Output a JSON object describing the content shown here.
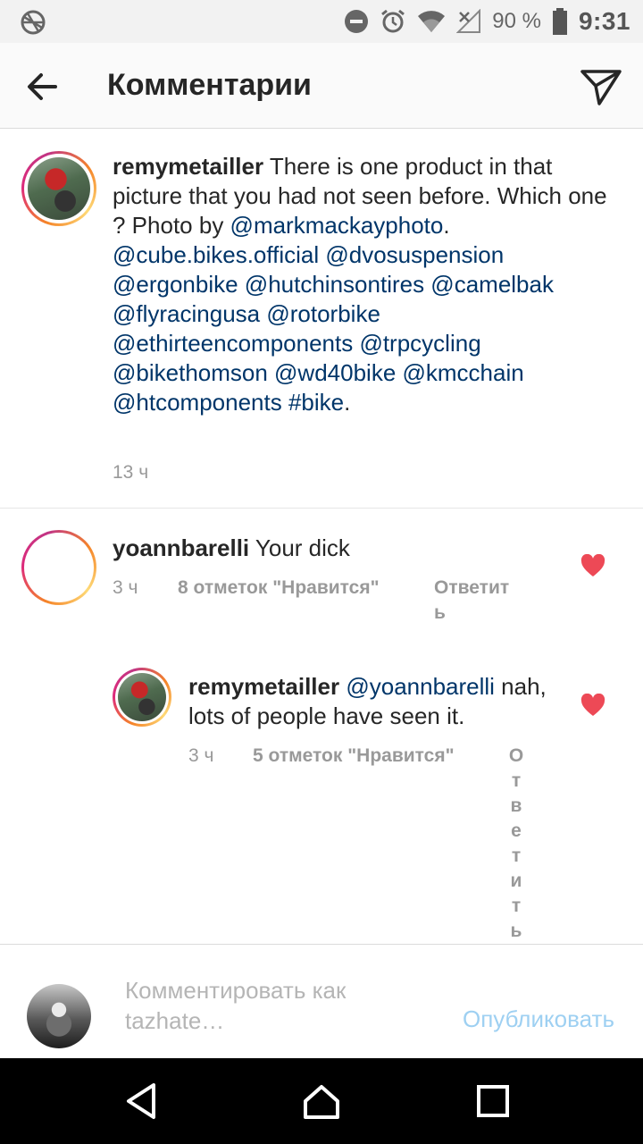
{
  "status_bar": {
    "battery_percent": "90 %",
    "time": "9:31",
    "icons": [
      "no-signal-globe-icon",
      "do-not-disturb-icon",
      "alarm-icon",
      "wifi-icon",
      "mobile-no-signal-icon",
      "battery-icon"
    ]
  },
  "app_bar": {
    "title": "Комментарии",
    "back_icon": "arrow-left-icon",
    "send_icon": "paper-plane-icon"
  },
  "caption": {
    "username": "remymetailler",
    "text_start": " There is one product in that picture that you had not seen before. Which one ? Photo by ",
    "mention_photo": "@markmackayphoto",
    "dot": ".",
    "mentions": "@cube.bikes.official @dvosuspension @ergonbike @hutchinsontires @camelbak @flyracingusa @rotorbike @ethirteencomponents @trpcycling @bikethomson @wd40bike @kmcchain @htcomponents #bike",
    "end": ".",
    "time": "13 ч"
  },
  "comments": [
    {
      "username": "yoannbarelli",
      "text": " Your dick",
      "time": "3 ч",
      "likes": "8 отметок \"Нравится\"",
      "reply": "Ответить",
      "liked": true
    },
    {
      "username": "remymetailler",
      "mention": "@yoannbarelli",
      "text": " nah, lots of people have seen it.",
      "time": "3 ч",
      "likes": "5 отметок \"Нравится\"",
      "reply": "Ответить",
      "liked": true
    }
  ],
  "comment_bar": {
    "placeholder": "Комментировать как tazhate…",
    "publish": "Опубликовать"
  },
  "colors": {
    "heart": "#ed4956",
    "mention": "#003569",
    "publish_disabled": "#9ed0f2"
  }
}
